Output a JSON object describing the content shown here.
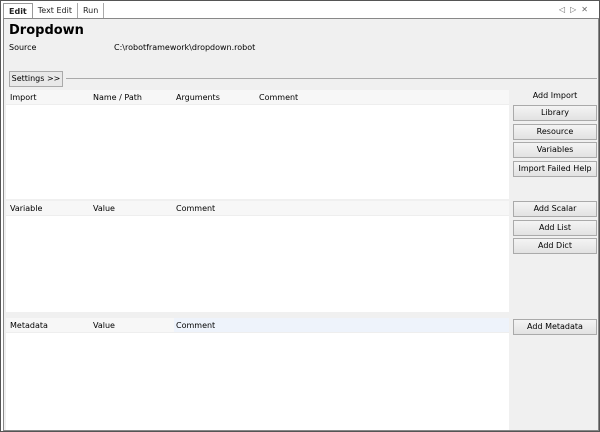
{
  "tabs": [
    {
      "label": "Edit",
      "active": true
    },
    {
      "label": "Text Edit"
    },
    {
      "label": "Run"
    }
  ],
  "nav_icons": [
    "arrow-left-icon",
    "arrow-right-icon",
    "close-icon"
  ],
  "title": "Dropdown",
  "source": {
    "label": "Source",
    "value": "C:\\robotframework\\dropdown.robot"
  },
  "settings_button": "Settings >>",
  "import_table": {
    "columns": [
      "Import",
      "Name / Path",
      "Arguments",
      "Comment"
    ]
  },
  "variable_table": {
    "columns": [
      "Variable",
      "Value",
      "Comment"
    ]
  },
  "metadata_table": {
    "columns": [
      "Metadata",
      "Value",
      "Comment"
    ]
  },
  "import_buttons": {
    "label": "Add Import",
    "buttons": [
      "Library",
      "Resource",
      "Variables",
      "Import Failed Help"
    ]
  },
  "variable_buttons": [
    "Add Scalar",
    "Add List",
    "Add Dict"
  ],
  "metadata_button": "Add Metadata"
}
